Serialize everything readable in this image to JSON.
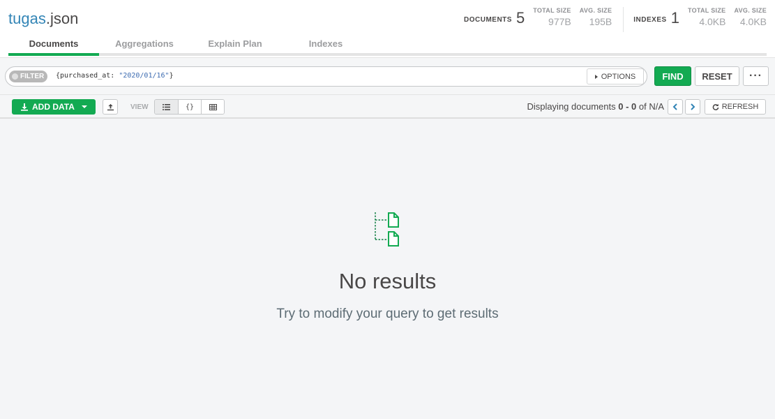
{
  "header": {
    "db_name": "tugas",
    "collection_name": ".json",
    "documents": {
      "label": "DOCUMENTS",
      "count": "5",
      "total_size_label": "TOTAL SIZE",
      "total_size": "977B",
      "avg_size_label": "AVG. SIZE",
      "avg_size": "195B"
    },
    "indexes": {
      "label": "INDEXES",
      "count": "1",
      "total_size_label": "TOTAL SIZE",
      "total_size": "4.0KB",
      "avg_size_label": "AVG. SIZE",
      "avg_size": "4.0KB"
    }
  },
  "tabs": [
    {
      "label": "Documents",
      "active": true
    },
    {
      "label": "Aggregations",
      "active": false
    },
    {
      "label": "Explain Plan",
      "active": false
    },
    {
      "label": "Indexes",
      "active": false
    }
  ],
  "query": {
    "filter_label": "FILTER",
    "filter_prefix": "{purchased_at: ",
    "filter_string": "\"2020/01/16\"",
    "filter_suffix": "}",
    "options_label": "OPTIONS",
    "find_label": "FIND",
    "reset_label": "RESET",
    "more_label": "···"
  },
  "toolbar": {
    "add_data_label": "ADD DATA",
    "view_label": "VIEW",
    "display_prefix": "Displaying documents ",
    "display_range": "0 - 0",
    "display_suffix": " of N/A",
    "refresh_label": "REFRESH"
  },
  "empty_state": {
    "title": "No results",
    "subtitle": "Try to modify your query to get results"
  },
  "colors": {
    "accent": "#13aa52",
    "link": "#3385b6"
  }
}
